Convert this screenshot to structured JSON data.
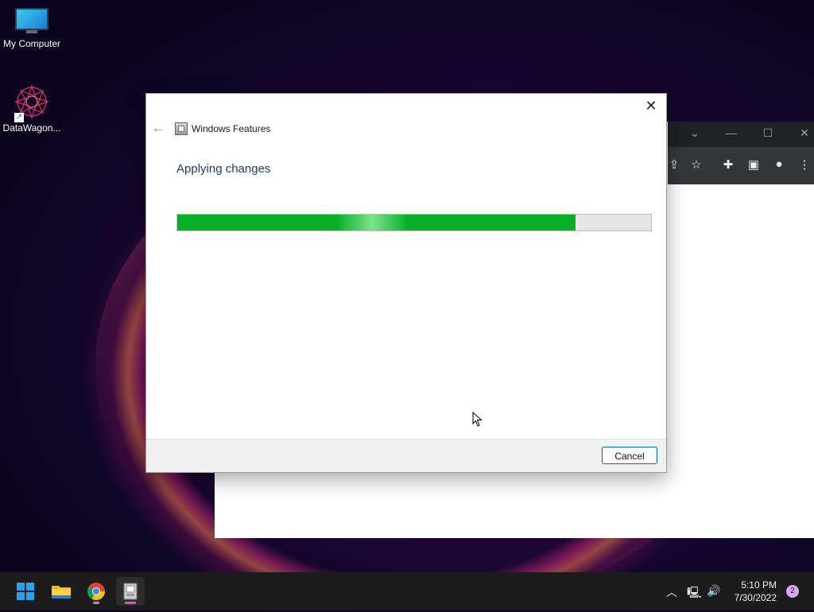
{
  "desktop": {
    "icons": [
      {
        "label": "My Computer",
        "icon": "monitor-icon"
      },
      {
        "label": "DataWagon...",
        "icon": "mandala-icon"
      }
    ]
  },
  "dialog": {
    "title": "Windows Features",
    "heading": "Applying changes",
    "progress_percent": 84,
    "cancel_label": "Cancel",
    "close_icon": "close-icon",
    "back_icon": "back-arrow-icon"
  },
  "taskbar": {
    "apps": [
      "windows-start-icon",
      "file-explorer-icon",
      "chrome-icon",
      "windows-features-icon"
    ],
    "time": "5:10 PM",
    "date": "7/30/2022",
    "notification_count": "2"
  },
  "colors": {
    "progress": "#06b025",
    "heading": "#1e3a6e",
    "button_border": "#0067c0",
    "taskbar": "#1c1c1c"
  }
}
